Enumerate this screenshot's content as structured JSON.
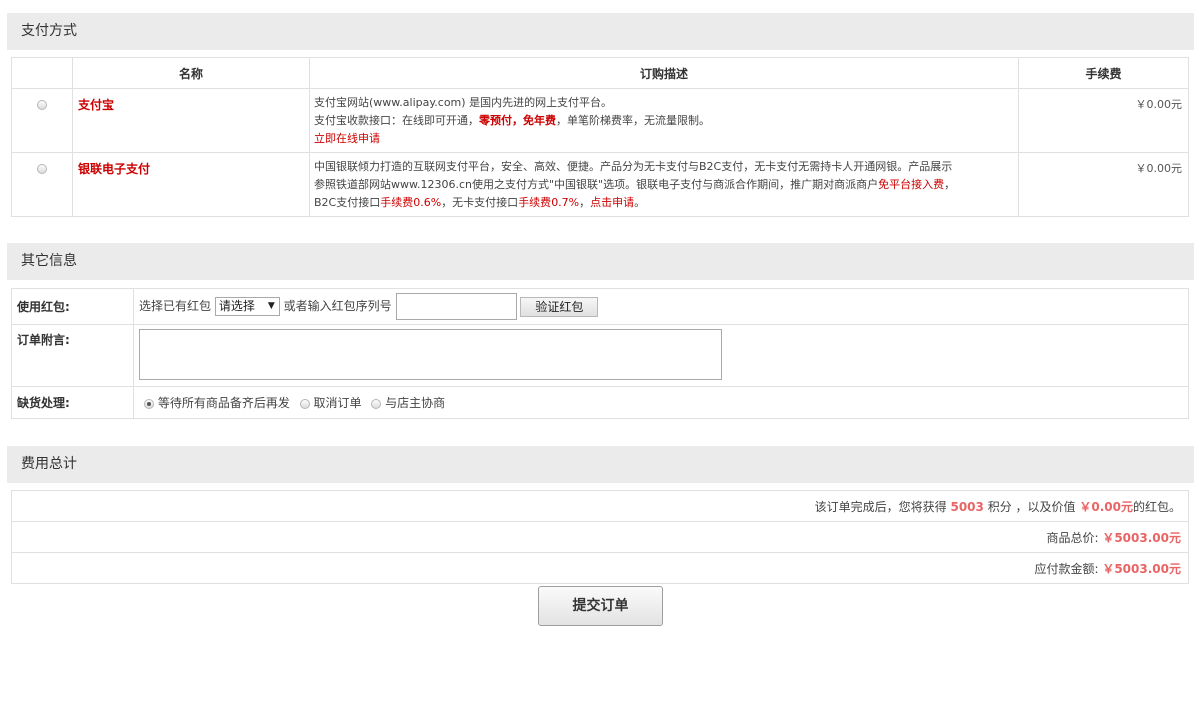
{
  "payment": {
    "section_title": "支付方式",
    "headers": {
      "name": "名称",
      "desc": "订购描述",
      "fee": "手续费"
    },
    "alipay": {
      "name": "支付宝",
      "line1": "支付宝网站(www.alipay.com) 是国内先进的网上支付平台。",
      "line2_pre": "支付宝收款接口：在线即可开通，",
      "line2_red": "零预付，免年费",
      "line2_post": "，单笔阶梯费率，无流量限制。",
      "apply": "立即在线申请",
      "fee": "￥0.00元"
    },
    "unionpay": {
      "name": "银联电子支付",
      "line1": "中国银联倾力打造的互联网支付平台，安全、高效、便捷。产品分为无卡支付与B2C支付，无卡支付无需持卡人开通网银。产品展示",
      "line2_pre": "参照铁道部网站www.12306.cn使用之支付方式\"中国银联\"选项。银联电子支付与商派合作期间，推广期对商派商户",
      "line2_red": "免平台接入费",
      "line2_post": "，",
      "line3_a": "B2C支付接口",
      "line3_b": "手续费",
      "line3_c": "0.6%",
      "line3_d": "，无卡支付接口",
      "line3_e": "手续费",
      "line3_f": "0.7%",
      "line3_g": "，",
      "line3_h": "点击申请",
      "line3_i": "。",
      "fee": "￥0.00元"
    }
  },
  "other": {
    "section_title": "其它信息",
    "redpacket": {
      "label": "使用红包:",
      "select_prefix": "选择已有红包",
      "select_value": "请选择",
      "or_text": "或者输入红包序列号",
      "input_value": "",
      "verify_button": "验证红包"
    },
    "note": {
      "label": "订单附言:",
      "value": ""
    },
    "shortage": {
      "label": "缺货处理:",
      "options": [
        "等待所有商品备齐后再发",
        "取消订单",
        "与店主协商"
      ],
      "selected_index": 0
    }
  },
  "total": {
    "section_title": "费用总计",
    "points_pre": "该订单完成后，您将获得",
    "points": "5003",
    "points_mid": "积分 ，以及价值",
    "bonus": "￥0.00元",
    "points_post": "的红包。",
    "goods_label": "商品总价:",
    "goods_value": "￥5003.00元",
    "payable_label": "应付款金额:",
    "payable_value": "￥5003.00元"
  },
  "submit_label": "提交订单"
}
